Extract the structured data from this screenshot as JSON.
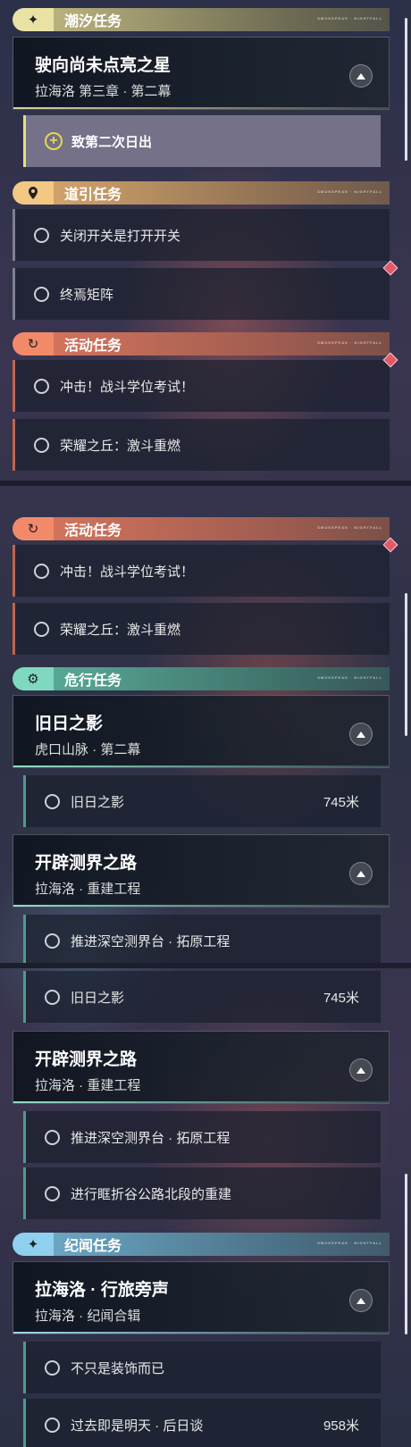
{
  "panel1": {
    "tide_header": "潮汐任务",
    "tide_quest": {
      "title": "驶向尚未点亮之星",
      "sub": "拉海洛 第三章 · 第二幕"
    },
    "tide_objective": "致第二次日出",
    "guide_header": "道引任务",
    "guide_items": [
      "关闭开关是打开开关",
      "终焉矩阵"
    ],
    "event_header": "活动任务",
    "event_items": [
      "冲击！战斗学位考试！",
      "荣耀之丘：激斗重燃"
    ]
  },
  "panel2": {
    "event_header": "活动任务",
    "event_items": [
      "冲击！战斗学位考试！",
      "荣耀之丘：激斗重燃"
    ],
    "danger_header": "危行任务",
    "quest_a": {
      "title": "旧日之影",
      "sub": "虎口山脉 · 第二幕"
    },
    "quest_a_objective": {
      "label": "旧日之影",
      "distance": "745米"
    },
    "quest_b": {
      "title": "开辟测界之路",
      "sub": "拉海洛 · 重建工程"
    },
    "quest_b_objective": "推进深空测界台 · 拓原工程"
  },
  "panel3": {
    "quest_a_objective": {
      "label": "旧日之影",
      "distance": "745米"
    },
    "quest_b": {
      "title": "开辟测界之路",
      "sub": "拉海洛 · 重建工程"
    },
    "quest_b_objectives": [
      "推进深空测界台 · 拓原工程",
      "进行眶折谷公路北段的重建"
    ],
    "lore_header": "纪闻任务",
    "lore_quest": {
      "title": "拉海洛 · 行旅旁声",
      "sub": "拉海洛 · 纪闻合辑"
    },
    "lore_objectives": [
      {
        "label": "不只是装饰而已",
        "distance": ""
      },
      {
        "label": "过去即是明天 · 后日谈",
        "distance": "958米"
      }
    ]
  },
  "colors": {
    "tide": "#e9e2a4",
    "guide": "#f3c882",
    "event": "#f28a6a",
    "danger": "#7fd9c1",
    "lore": "#8fd0ee",
    "marker": "#e05a6a"
  },
  "icons": {
    "tide": "sparkle-icon",
    "guide": "map-pin-icon",
    "event": "refresh-icon",
    "danger": "gear-icon",
    "lore": "sparkle-icon",
    "collapse": "chevron-up-icon",
    "objective": "circle-icon",
    "tracked": "plus-icon"
  }
}
